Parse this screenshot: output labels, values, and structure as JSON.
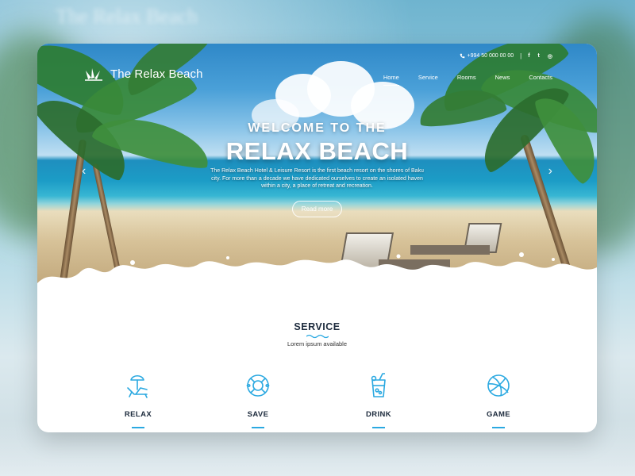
{
  "brand": {
    "name": "The Relax Beach",
    "logo_icon": "fan-logo-icon"
  },
  "topbar": {
    "phone": "+994 50 000 00 00",
    "phone_icon": "phone-icon",
    "separator": "|",
    "social": [
      {
        "icon": "facebook-icon",
        "glyph": "f"
      },
      {
        "icon": "twitter-icon",
        "glyph": "t"
      },
      {
        "icon": "instagram-icon",
        "glyph": "◎"
      }
    ]
  },
  "nav": {
    "items": [
      {
        "label": "Home",
        "active": true
      },
      {
        "label": "Service",
        "active": false
      },
      {
        "label": "Rooms",
        "active": false
      },
      {
        "label": "News",
        "active": false
      },
      {
        "label": "Contacts",
        "active": false
      }
    ]
  },
  "hero": {
    "welcome": "WELCOME TO THE",
    "headline": "RELAX BEACH",
    "description": "The Relax Beach Hotel & Leisure Resort is the first beach resort on the shores of Baku city. For more than a decade we have dedicated ourselves to create an isolated haven within a city, a place of retreat and recreation.",
    "button": "Read more",
    "prev_glyph": "‹",
    "next_glyph": "›"
  },
  "service": {
    "title": "SERVICE",
    "subtitle": "Lorem ipsum available",
    "accent": "#2ba9e1",
    "features": [
      {
        "label": "RELAX",
        "icon": "sunbed-umbrella-icon"
      },
      {
        "label": "SAVE",
        "icon": "lifebuoy-icon"
      },
      {
        "label": "DRINK",
        "icon": "cocktail-glass-icon"
      },
      {
        "label": "GAME",
        "icon": "beach-ball-icon"
      }
    ]
  }
}
